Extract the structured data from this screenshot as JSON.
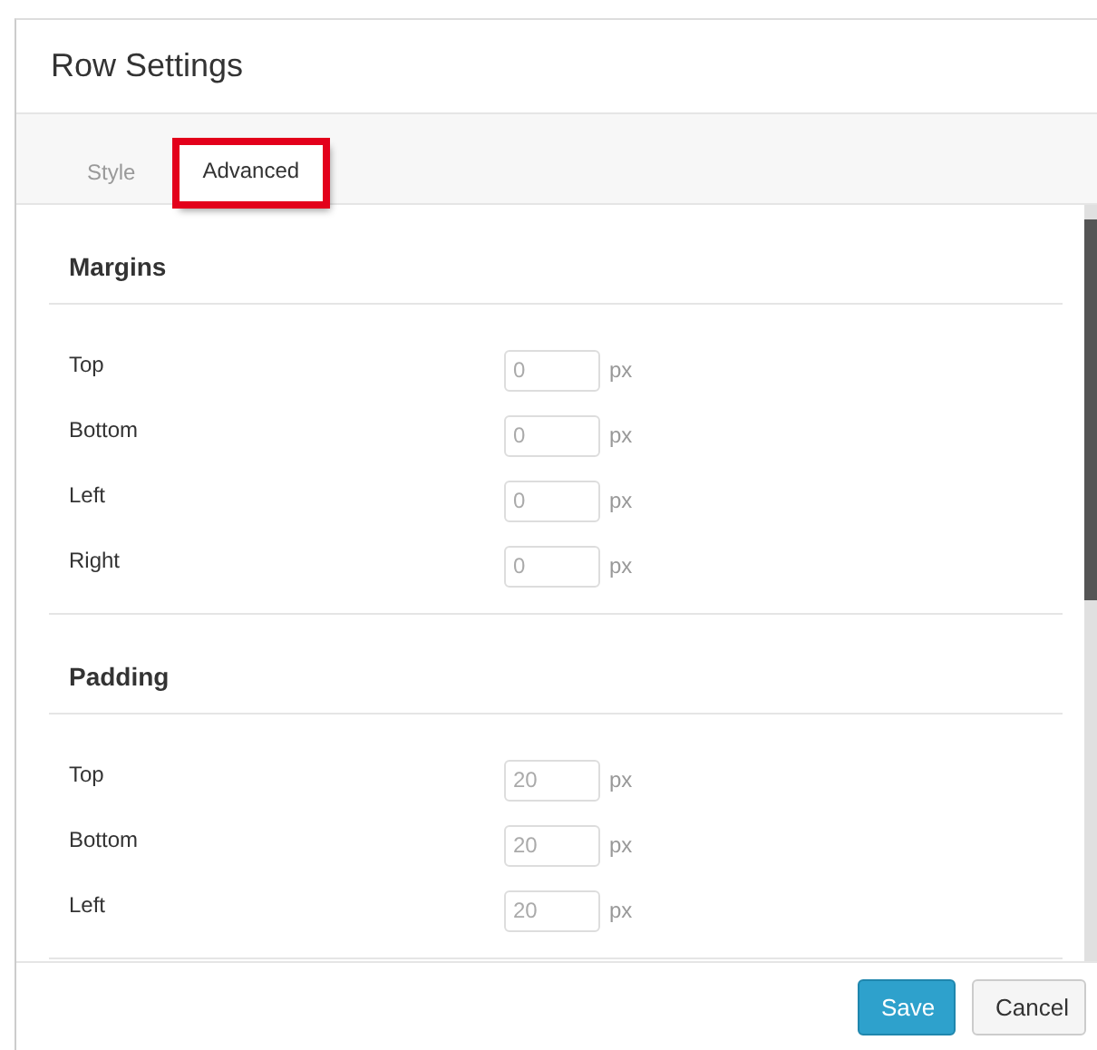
{
  "dialog": {
    "title": "Row Settings"
  },
  "tabs": [
    {
      "label": "Style",
      "selected": false,
      "highlighted": false
    },
    {
      "label": "Advanced",
      "selected": true,
      "highlighted": true
    }
  ],
  "sections": [
    {
      "heading": "Margins",
      "fields": [
        {
          "label": "Top",
          "placeholder": "0",
          "unit": "px"
        },
        {
          "label": "Bottom",
          "placeholder": "0",
          "unit": "px"
        },
        {
          "label": "Left",
          "placeholder": "0",
          "unit": "px"
        },
        {
          "label": "Right",
          "placeholder": "0",
          "unit": "px"
        }
      ]
    },
    {
      "heading": "Padding",
      "fields": [
        {
          "label": "Top",
          "placeholder": "20",
          "unit": "px"
        },
        {
          "label": "Bottom",
          "placeholder": "20",
          "unit": "px"
        },
        {
          "label": "Left",
          "placeholder": "20",
          "unit": "px"
        }
      ]
    }
  ],
  "buttons": [
    {
      "label": "Save",
      "kind": "primary"
    },
    {
      "label": "Cancel",
      "kind": "default"
    }
  ]
}
